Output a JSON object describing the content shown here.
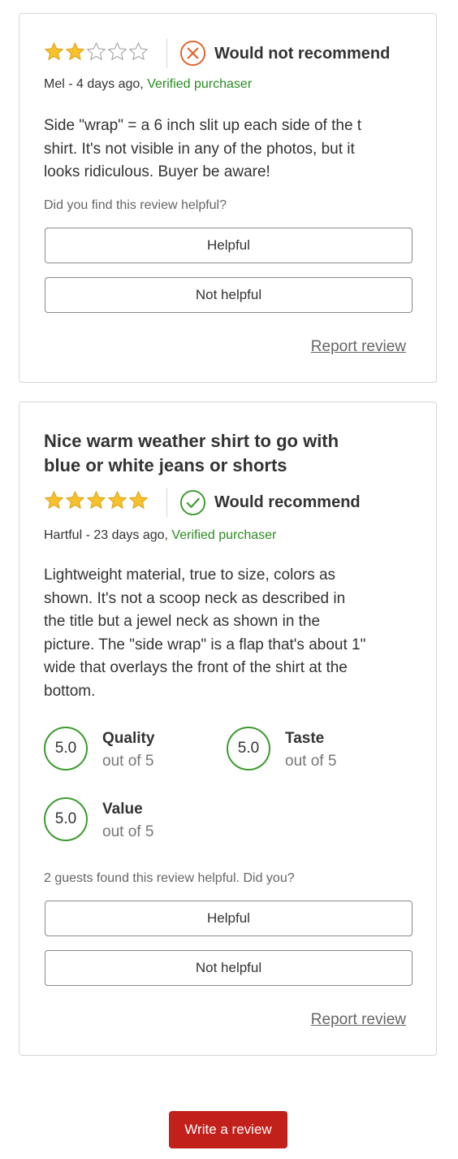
{
  "reviews": [
    {
      "rating": 2,
      "max_rating": 5,
      "recommend_label": "Would not recommend",
      "recommend": false,
      "author_line": "Mel - 4 days ago,",
      "verified": "Verified purchaser",
      "body_lines": [
        "Side \"wrap\" = a 6 inch slit up each side of the t",
        "shirt. It's not visible in any of the photos, but it",
        "looks ridiculous. Buyer be aware!"
      ],
      "question": "Did you find this review helpful?",
      "helpful_label": "Helpful",
      "not_helpful_label": "Not helpful",
      "report_label": "Report review"
    },
    {
      "title_lines": [
        "Nice warm weather shirt to go with",
        "blue or white jeans or shorts"
      ],
      "rating": 5,
      "max_rating": 5,
      "recommend_label": "Would recommend",
      "recommend": true,
      "author_line": "Hartful - 23 days ago,",
      "verified": "Verified purchaser",
      "body_lines": [
        "Lightweight material, true to size, colors as",
        "shown. It's not a scoop neck as described in",
        "the title but a jewel neck as shown in the",
        "picture. The \"side wrap\" is a flap that's about 1\"",
        "wide that overlays the front of the shirt at the",
        "bottom."
      ],
      "scores": [
        {
          "value": "5.0",
          "label": "Quality",
          "sub": "out of 5"
        },
        {
          "value": "5.0",
          "label": "Taste",
          "sub": "out of 5"
        },
        {
          "value": "5.0",
          "label": "Value",
          "sub": "out of 5"
        }
      ],
      "question": "2 guests found this review helpful. Did you?",
      "helpful_label": "Helpful",
      "not_helpful_label": "Not helpful",
      "report_label": "Report review"
    }
  ],
  "write_review_label": "Write a review",
  "colors": {
    "star_filled": "#f6c12a",
    "star_empty_stroke": "#9a9a9a",
    "not_recommend": "#e0632a",
    "recommend": "#3c9a2f",
    "verified": "#2c8a22",
    "write_button": "#c1201b"
  },
  "icons": {
    "star": "star-icon",
    "not_recommend": "x-circle-icon",
    "recommend": "check-circle-icon"
  }
}
